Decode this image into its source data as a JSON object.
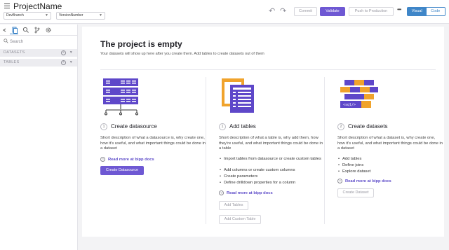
{
  "header": {
    "title": "ProjectName",
    "branch_value": "DevBranch",
    "version_value": "VersionNumber",
    "undo_icon": "undo-icon",
    "redo_icon": "redo-icon",
    "commit_label": "Commit",
    "validate_label": "Validate",
    "push_label": "Push to Production",
    "more_label": "•••",
    "view_visual": "Visual",
    "view_code": "Code"
  },
  "sidebar": {
    "tabs": [
      "collapse-icon",
      "files-icon",
      "search-icon",
      "branch-icon",
      "settings-icon"
    ],
    "search_placeholder": "Search",
    "sections": [
      {
        "label": "DATASETS"
      },
      {
        "label": "TABLES"
      }
    ]
  },
  "main": {
    "title": "The project is empty",
    "subtitle": "Your datasets will show up here after you create them. Add tables to create datasets out of them",
    "columns": [
      {
        "number": "1",
        "title": "Create datasource",
        "description": "Short description of what a datasource is, why create one, how it's useful, and what important things could be done in a dataset",
        "bullets": [],
        "docs_link": "Read more at bipp docs",
        "buttons": [
          "Create Datasource"
        ]
      },
      {
        "number": "1",
        "title": "Add tables",
        "description": "Short description of what a table is, why add them, how they're useful, and what important things could be done in a table",
        "bullets": [
          "Import tables from datasource or create custom tables",
          "Add columns or create custom columns",
          "Create parameters",
          "Define drilldown properties for a column"
        ],
        "docs_link": "Read more at bipp docs",
        "buttons": [
          "Add Tables",
          "Add Custom Table"
        ]
      },
      {
        "number": "2",
        "title": "Create datasets",
        "description": "Short description of what a dataset is, why create one, how it's useful, and what important things could be done in a dataset",
        "bullets": [
          "Add tables",
          "Define joins",
          "Explore dataset"
        ],
        "docs_link": "Read more at bipp docs",
        "buttons": [
          "Create Dataset"
        ]
      }
    ],
    "illustration_sql_label": "<sql/>"
  },
  "colors": {
    "accent": "#6e58d3",
    "toggle": "#3f86c8",
    "illustration_purple": "#5e47c9",
    "illustration_orange": "#f0a32c"
  }
}
